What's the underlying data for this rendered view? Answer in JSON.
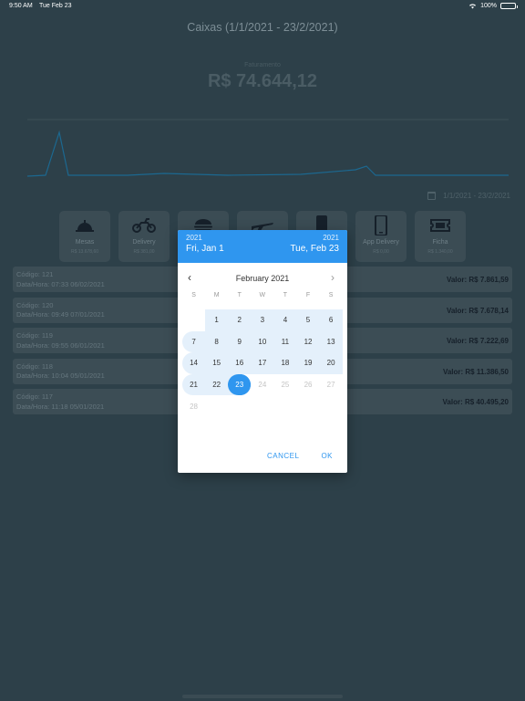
{
  "status": {
    "time": "9:50 AM",
    "date": "Tue Feb 23",
    "battery": "100%"
  },
  "header": {
    "title": "Caixas (1/1/2021 - 23/2/2021)"
  },
  "summary": {
    "label": "Faturamento",
    "total": "R$ 74.644,12"
  },
  "filter": {
    "range": "1/1/2021 - 23/2/2021"
  },
  "tiles": [
    {
      "name": "Mesas",
      "value": "R$ 13.678,60",
      "icon": "bell-icon"
    },
    {
      "name": "Delivery",
      "value": "R$ 381,00",
      "icon": "motorcycle-icon"
    },
    {
      "name": "",
      "value": "",
      "icon": "burger-icon"
    },
    {
      "name": "",
      "value": "",
      "icon": "plane-icon"
    },
    {
      "name": "",
      "value": "",
      "icon": "phone-icon"
    },
    {
      "name": "App Delivery",
      "value": "R$ 0,00",
      "icon": "smartphone-icon"
    },
    {
      "name": "Ficha",
      "value": "R$ 1.340,00",
      "icon": "ticket-icon"
    }
  ],
  "rows": [
    {
      "code": "Código: 121",
      "datetime": "Data/Hora: 07:33 06/02/2021",
      "valor": "Valor: R$ 7.861,59"
    },
    {
      "code": "Código: 120",
      "datetime": "Data/Hora: 09:49 07/01/2021",
      "valor": "Valor: R$ 7.678,14"
    },
    {
      "code": "Código: 119",
      "datetime": "Data/Hora: 09:55 06/01/2021",
      "valor": "Valor: R$ 7.222,69"
    },
    {
      "code": "Código: 118",
      "datetime": "Data/Hora: 10:04 05/01/2021",
      "valor": "Valor: R$ 11.386,50"
    },
    {
      "code": "Código: 117",
      "datetime": "Data/Hora: 11:18 05/01/2021",
      "valor": "Valor: R$ 40.495,20"
    }
  ],
  "picker": {
    "start_year": "2021",
    "start_date": "Fri, Jan 1",
    "end_year": "2021",
    "end_date": "Tue, Feb 23",
    "month": "February 2021",
    "weekdays": [
      "S",
      "M",
      "T",
      "W",
      "T",
      "F",
      "S"
    ],
    "first_weekday": 1,
    "days": [
      "1",
      "2",
      "3",
      "4",
      "5",
      "6",
      "7",
      "8",
      "9",
      "10",
      "11",
      "12",
      "13",
      "14",
      "15",
      "16",
      "17",
      "18",
      "19",
      "20",
      "21",
      "22",
      "23",
      "24",
      "25",
      "26",
      "27",
      "28"
    ],
    "selected_end": "23",
    "cancel": "CANCEL",
    "ok": "OK"
  },
  "colors": {
    "accent": "#2f96ef",
    "background": "#2d4049",
    "range": "#e4f0fb"
  }
}
